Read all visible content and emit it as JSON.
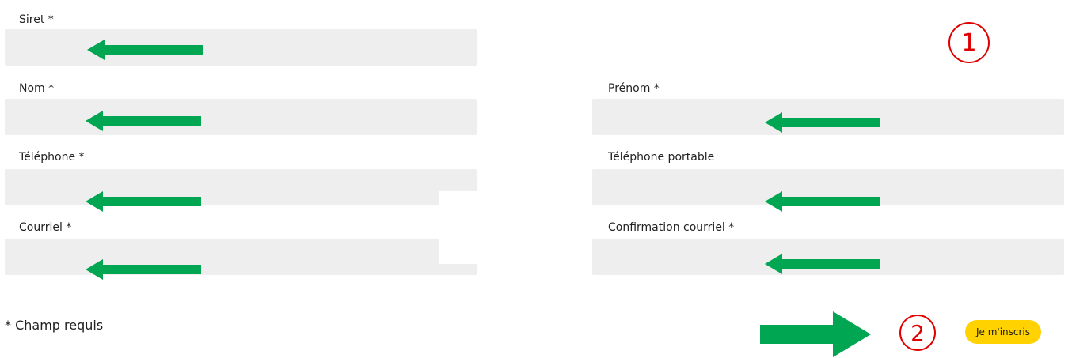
{
  "form": {
    "siret": {
      "label": "Siret *",
      "value": ""
    },
    "nom": {
      "label": "Nom *",
      "value": ""
    },
    "prenom": {
      "label": "Prénom *",
      "value": ""
    },
    "telephone": {
      "label": "Téléphone *",
      "value": ""
    },
    "telephone_portable": {
      "label": "Téléphone portable",
      "value": ""
    },
    "courriel": {
      "label": "Courriel *",
      "value": ""
    },
    "confirmation_courriel": {
      "label": "Confirmation courriel *",
      "value": ""
    },
    "required_note": "* Champ requis",
    "submit_label": "Je m'inscris"
  },
  "annotations": {
    "step1": "1",
    "step2": "2"
  },
  "colors": {
    "field_bg": "#eeeeee",
    "arrow_green": "#00a651",
    "badge_red": "#e00000",
    "button_yellow": "#ffd200"
  },
  "icons": {
    "field_pointer": "arrow-left-icon",
    "button_pointer": "arrow-right-icon"
  }
}
